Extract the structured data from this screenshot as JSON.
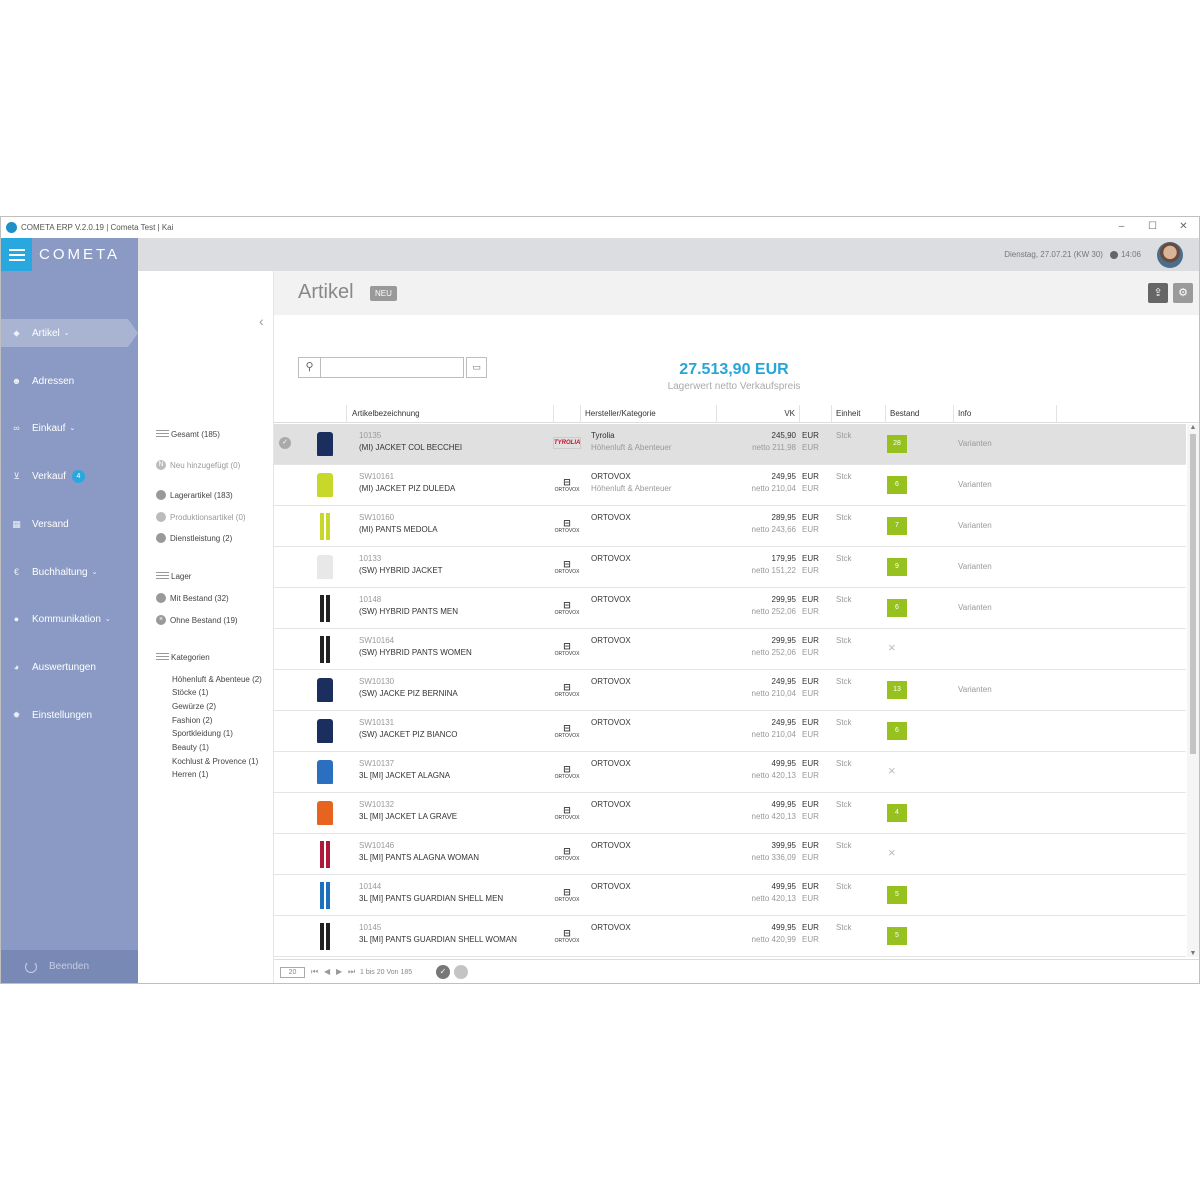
{
  "window": {
    "title": "COMETA ERP V.2.0.19 | Cometa Test | Kai",
    "controls": {
      "minimize": "–",
      "maximize": "☐",
      "close": "✕"
    }
  },
  "header": {
    "logo_text": "COMETA",
    "date": "Dienstag, 27.07.21 (KW 30)",
    "time": "14:06"
  },
  "sidebar": {
    "items": [
      {
        "label": "Artikel",
        "icon": "tag-icon",
        "chevron": true,
        "active": true
      },
      {
        "label": "Adressen",
        "icon": "smiley-icon"
      },
      {
        "label": "Einkauf",
        "icon": "binoculars-icon",
        "chevron": true
      },
      {
        "label": "Verkauf",
        "icon": "cart-icon",
        "badge": "4"
      },
      {
        "label": "Versand",
        "icon": "building-icon"
      },
      {
        "label": "Buchhaltung",
        "icon": "euro-icon",
        "chevron": true
      },
      {
        "label": "Kommunikation",
        "icon": "chat-icon",
        "chevron": true
      },
      {
        "label": "Auswertungen",
        "icon": "pie-chart-icon"
      },
      {
        "label": "Einstellungen",
        "icon": "gear-icon"
      }
    ],
    "quit_label": "Beenden"
  },
  "filters": {
    "total": "Gesamt (185)",
    "new_added": "Neu hinzugefügt (0)",
    "stock_article": "Lagerartikel (183)",
    "production_article": "Produktionsartikel (0)",
    "service": "Dienstleistung (2)",
    "stock_heading": "Lager",
    "with_stock": "Mit Bestand (32)",
    "without_stock": "Ohne Bestand (19)",
    "categories_heading": "Kategorien",
    "categories": [
      "Höhenluft & Abenteue (2)",
      "Stöcke (1)",
      "Gewürze (2)",
      "Fashion (2)",
      "Sportkleidung (1)",
      "Beauty (1)",
      "Kochlust & Provence (1)",
      "Herren (1)"
    ]
  },
  "main": {
    "title": "Artikel",
    "new_tag": "NEU",
    "search_placeholder": "",
    "stock_value": "27.513,90 EUR",
    "stock_value_label": "Lagerwert netto Verkaufspreis"
  },
  "table": {
    "columns": {
      "name": "Artikelbezeichnung",
      "brand": "Hersteller/Kategorie",
      "vk": "VK",
      "unit": "Einheit",
      "stock": "Bestand",
      "info": "Info"
    },
    "rows": [
      {
        "no": "10135",
        "name": "(MI) JACKET COL BECCHEI",
        "brand": "Tyrolia",
        "brand_logo": "TYROLIA",
        "category": "Höhenluft & Abenteuer",
        "vk": "245,90",
        "netto": "netto 211,98",
        "cur": "EUR",
        "unit": "Stck",
        "stock": "28",
        "info": "Varianten",
        "kind": "jacket",
        "color": "#1b2f5e",
        "selected": true
      },
      {
        "no": "SW10161",
        "name": "(MI) JACKET PIZ DULEDA",
        "brand": "ORTOVOX",
        "brand_logo": "ORTOVOX",
        "category": "Höhenluft & Abenteuer",
        "vk": "249,95",
        "netto": "netto 210,04",
        "cur": "EUR",
        "unit": "Stck",
        "stock": "6",
        "info": "Varianten",
        "kind": "jacket",
        "color": "#c8d82a"
      },
      {
        "no": "SW10160",
        "name": "(MI) PANTS MEDOLA",
        "brand": "ORTOVOX",
        "brand_logo": "ORTOVOX",
        "category": "",
        "vk": "289,95",
        "netto": "netto 243,66",
        "cur": "EUR",
        "unit": "Stck",
        "stock": "7",
        "info": "Varianten",
        "kind": "pants",
        "color": "#c8d82a"
      },
      {
        "no": "10133",
        "name": "(SW) HYBRID JACKET",
        "brand": "ORTOVOX",
        "brand_logo": "ORTOVOX",
        "category": "",
        "vk": "179,95",
        "netto": "netto 151,22",
        "cur": "EUR",
        "unit": "Stck",
        "stock": "9",
        "info": "Varianten",
        "kind": "jacket",
        "color": "#e8e8e8"
      },
      {
        "no": "10148",
        "name": "(SW) HYBRID PANTS MEN",
        "brand": "ORTOVOX",
        "brand_logo": "ORTOVOX",
        "category": "",
        "vk": "299,95",
        "netto": "netto 252,06",
        "cur": "EUR",
        "unit": "Stck",
        "stock": "6",
        "info": "Varianten",
        "kind": "pants",
        "color": "#222222"
      },
      {
        "no": "SW10164",
        "name": "(SW) HYBRID PANTS WOMEN",
        "brand": "ORTOVOX",
        "brand_logo": "ORTOVOX",
        "category": "",
        "vk": "299,95",
        "netto": "netto 252,06",
        "cur": "EUR",
        "unit": "Stck",
        "stock": "",
        "info": "",
        "kind": "pants",
        "color": "#222222"
      },
      {
        "no": "SW10130",
        "name": "(SW) JACKE PIZ BERNINA",
        "brand": "ORTOVOX",
        "brand_logo": "ORTOVOX",
        "category": "",
        "vk": "249,95",
        "netto": "netto 210,04",
        "cur": "EUR",
        "unit": "Stck",
        "stock": "13",
        "info": "Varianten",
        "kind": "jacket",
        "color": "#1b2f5e"
      },
      {
        "no": "SW10131",
        "name": "(SW) JACKET PIZ BIANCO",
        "brand": "ORTOVOX",
        "brand_logo": "ORTOVOX",
        "category": "",
        "vk": "249,95",
        "netto": "netto 210,04",
        "cur": "EUR",
        "unit": "Stck",
        "stock": "6",
        "info": "",
        "kind": "jacket",
        "color": "#1b2f5e"
      },
      {
        "no": "SW10137",
        "name": "3L [MI] JACKET ALAGNA",
        "brand": "ORTOVOX",
        "brand_logo": "ORTOVOX",
        "category": "",
        "vk": "499,95",
        "netto": "netto 420,13",
        "cur": "EUR",
        "unit": "Stck",
        "stock": "",
        "info": "",
        "kind": "jacket",
        "color": "#2b6fc0"
      },
      {
        "no": "SW10132",
        "name": "3L [MI] JACKET LA GRAVE",
        "brand": "ORTOVOX",
        "brand_logo": "ORTOVOX",
        "category": "",
        "vk": "499,95",
        "netto": "netto 420,13",
        "cur": "EUR",
        "unit": "Stck",
        "stock": "4",
        "info": "",
        "kind": "jacket",
        "color": "#e8641e"
      },
      {
        "no": "SW10146",
        "name": "3L [MI] PANTS ALAGNA WOMAN",
        "brand": "ORTOVOX",
        "brand_logo": "ORTOVOX",
        "category": "",
        "vk": "399,95",
        "netto": "netto 336,09",
        "cur": "EUR",
        "unit": "Stck",
        "stock": "",
        "info": "",
        "kind": "pants",
        "color": "#b0183a"
      },
      {
        "no": "10144",
        "name": "3L [MI] PANTS GUARDIAN SHELL MEN",
        "brand": "ORTOVOX",
        "brand_logo": "ORTOVOX",
        "category": "",
        "vk": "499,95",
        "netto": "netto 420,13",
        "cur": "EUR",
        "unit": "Stck",
        "stock": "5",
        "info": "",
        "kind": "pants",
        "color": "#1f6fc0"
      },
      {
        "no": "10145",
        "name": "3L [MI] PANTS GUARDIAN SHELL WOMAN",
        "brand": "ORTOVOX",
        "brand_logo": "ORTOVOX",
        "category": "",
        "vk": "499,95",
        "netto": "netto 420,99",
        "cur": "EUR",
        "unit": "Stck",
        "stock": "5",
        "info": "",
        "kind": "pants",
        "color": "#222222"
      }
    ]
  },
  "pager": {
    "page_size": "20",
    "range_text": "1 bis 20 Von 185"
  },
  "colors": {
    "accent": "#29a8df",
    "sidebar": "#8a9ac4",
    "stock_badge": "#96c11f"
  }
}
